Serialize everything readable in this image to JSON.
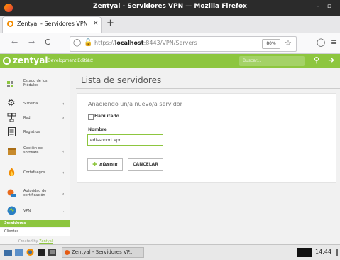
{
  "window": {
    "title": "Zentyal - Servidores VPN — Mozilla Firefox",
    "controls": "– ▫"
  },
  "tab": {
    "label": "Zentyal - Servidores VPN",
    "close": "×",
    "new_tab": "+"
  },
  "navbar": {
    "back": "←",
    "forward": "→",
    "reload": "C",
    "url_prefix": "https://",
    "url_host": "localhost",
    "url_rest": ":8443/VPN/Servers",
    "zoom": "80%"
  },
  "zentyal": {
    "logo": "zentyal",
    "edition": "Development Edition",
    "version": "4.2",
    "search_placeholder": "Buscar..."
  },
  "sidebar": {
    "items": [
      {
        "label": "Estado de los Módulos",
        "icon": "module-status-icon"
      },
      {
        "label": "Sistema",
        "icon": "system-gear-icon",
        "chevron": "‹"
      },
      {
        "label": "Red",
        "icon": "network-icon",
        "chevron": "‹"
      },
      {
        "label": "Registros",
        "icon": "logs-icon"
      },
      {
        "label": "Gestión de software",
        "icon": "software-management-icon",
        "chevron": "‹"
      },
      {
        "label": "Cortafuegos",
        "icon": "firewall-icon",
        "chevron": "‹"
      },
      {
        "label": "Autoridad de certificación",
        "icon": "certificate-authority-icon",
        "chevron": "‹"
      },
      {
        "label": "VPN",
        "icon": "vpn-icon",
        "chevron": "⌄"
      }
    ],
    "subitems": [
      {
        "label": "Servidores",
        "active": true
      },
      {
        "label": "Clientes",
        "active": false
      }
    ],
    "created_by_prefix": "Created by ",
    "created_by_link": "Zentyal"
  },
  "main": {
    "page_title": "Lista de servidores",
    "form_title": "Añadiendo un/a nuevo/a servidor",
    "enabled_label": "Habilitado",
    "name_label": "Nombre",
    "name_value": "edissonort vpn",
    "add_button": "AÑADIR",
    "cancel_button": "CANCELAR"
  },
  "taskbar": {
    "task_label": "Zentyal - Servidores VP...",
    "clock": "14:44"
  },
  "colors": {
    "zentyal_green": "#8dc63f",
    "firefox_titlebar": "#2b2b2b"
  }
}
